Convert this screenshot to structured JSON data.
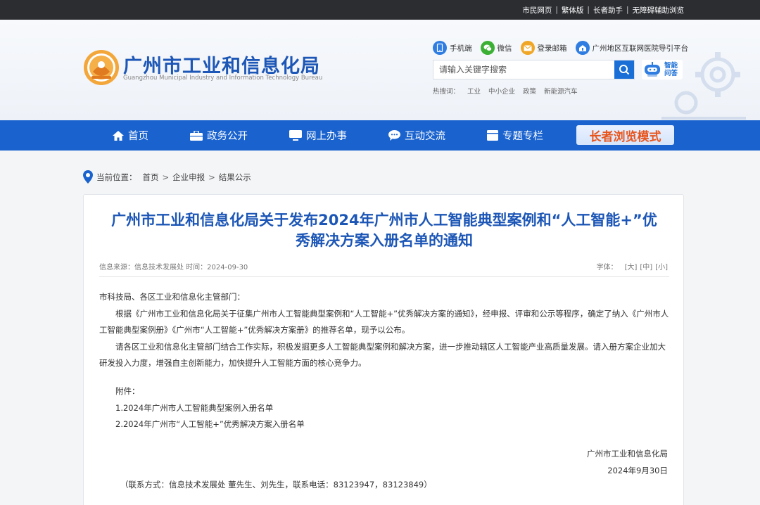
{
  "topbar": {
    "links": [
      "市民网页",
      "繁体版",
      "长者助手",
      "无障碍辅助浏览"
    ]
  },
  "header": {
    "site_title": "广州市工业和信息化局",
    "site_subtitle": "Guangzhou Municipal Industry and Information Technology Bureau",
    "quick_links": {
      "mobile": "手机端",
      "wechat": "微信",
      "mail": "登录邮箱",
      "hospital": "广州地区互联网医院导引平台"
    },
    "search": {
      "placeholder": "请输入关键字搜索"
    },
    "ai_assistant": {
      "line1": "智能",
      "line2": "问答"
    },
    "hot_search": {
      "label": "热搜词：",
      "terms": [
        "工业",
        "中小企业",
        "政策",
        "新能源汽车"
      ]
    }
  },
  "nav": {
    "items": [
      "首页",
      "政务公开",
      "网上办事",
      "互动交流",
      "专题专栏"
    ],
    "elder_mode": "长者浏览模式"
  },
  "breadcrumb": {
    "label": "当前位置：",
    "items": [
      "首页",
      "企业申报",
      "结果公示"
    ]
  },
  "article": {
    "title": "广州市工业和信息化局关于发布2024年广州市人工智能典型案例和“人工智能+”优秀解决方案入册名单的通知",
    "meta": "信息来源：信息技术发展处  时间：2024-09-30",
    "font_label": "字体：",
    "font_options": [
      "[大]",
      "[中]",
      "[小]"
    ],
    "salutation": "市科技局、各区工业和信息化主管部门：",
    "paragraphs": [
      "根据《广州市工业和信息化局关于征集广州市人工智能典型案例和“人工智能+”优秀解决方案的通知》，经申报、评审和公示等程序，确定了纳入《广州市人工智能典型案例册》《广州市“人工智能+”优秀解决方案册》的推荐名单，现予以公布。",
      "请各区工业和信息化主管部门结合工作实际，积极发掘更多人工智能典型案例和解决方案，进一步推动辖区人工智能产业高质量发展。请入册方案企业加大研发投入力度，增强自主创新能力，加快提升人工智能方面的核心竞争力。"
    ],
    "attachments_label": "附件：",
    "attachments": [
      "1.2024年广州市人工智能典型案例入册名单",
      "2.2024年广州市“人工智能+”优秀解决方案入册名单"
    ],
    "signature": "广州市工业和信息化局",
    "date": "2024年9月30日",
    "contact": "（联系方式：信息技术发展处 董先生、刘先生，联系电话：83123947，83123849）"
  },
  "colors": {
    "brand_blue": "#1c56b6",
    "nav_blue": "#1a63cf",
    "elder_orange": "#e8541b",
    "topbar_dark": "#2b2d31"
  }
}
